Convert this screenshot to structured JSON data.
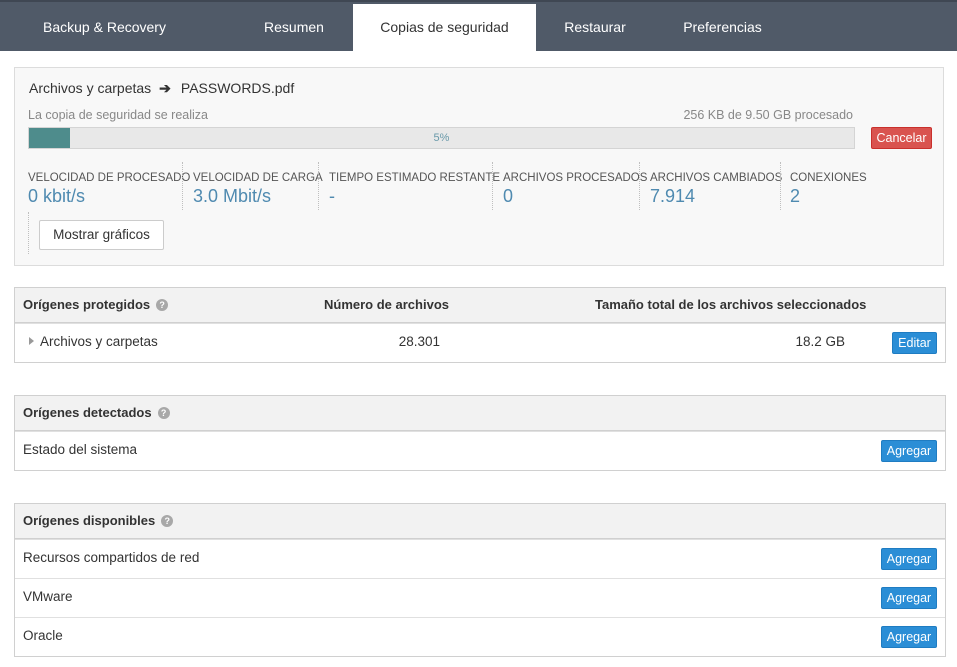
{
  "nav": {
    "brand": "Backup & Recovery",
    "tabs": [
      "Resumen",
      "Copias de seguridad",
      "Restaurar",
      "Preferencias"
    ],
    "active_tab": "Copias de seguridad"
  },
  "progress": {
    "breadcrumb_folder": "Archivos y carpetas",
    "breadcrumb_file": "PASSWORDS.pdf",
    "status_text": "La copia de seguridad se realiza",
    "processed_text": "256 KB de 9.50 GB procesado",
    "percent_label": "5%",
    "percent": 5,
    "cancel_label": "Cancelar",
    "show_charts_label": "Mostrar gráficos",
    "stats": [
      {
        "label": "VELOCIDAD DE PROCESADO",
        "value": "0 kbit/s"
      },
      {
        "label": "VELOCIDAD DE CARGA",
        "value": "3.0 Mbit/s"
      },
      {
        "label": "TIEMPO ESTIMADO RESTANTE",
        "value": "-"
      },
      {
        "label": "ARCHIVOS PROCESADOS",
        "value": "0"
      },
      {
        "label": "ARCHIVOS CAMBIADOS",
        "value": "7.914"
      },
      {
        "label": "CONEXIONES",
        "value": "2"
      }
    ]
  },
  "protected": {
    "title": "Orígenes protegidos",
    "col_files": "Número de archivos",
    "col_size": "Tamaño total de los archivos seleccionados",
    "rows": [
      {
        "name": "Archivos y carpetas",
        "files": "28.301",
        "size": "18.2 GB",
        "action": "Editar"
      }
    ]
  },
  "detected": {
    "title": "Orígenes detectados",
    "rows": [
      {
        "name": "Estado del sistema",
        "action": "Agregar"
      }
    ]
  },
  "available": {
    "title": "Orígenes disponibles",
    "rows": [
      {
        "name": "Recursos compartidos de red",
        "action": "Agregar"
      },
      {
        "name": "VMware",
        "action": "Agregar"
      },
      {
        "name": "Oracle",
        "action": "Agregar"
      }
    ]
  },
  "colors": {
    "nav_bg": "#505a68",
    "accent_blue": "#2b8ed6",
    "cancel_red": "#d9534f",
    "progress_fill": "#4e8c8c",
    "stat_value": "#4f8ab0"
  }
}
